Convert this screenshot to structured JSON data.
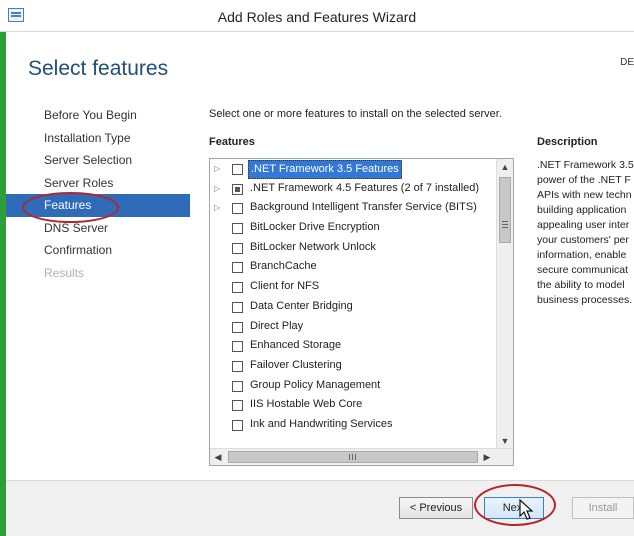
{
  "window": {
    "title": "Add Roles and Features Wizard",
    "icon": "server-manager-icon"
  },
  "header": {
    "page_title": "Select features",
    "destination_server": "DE"
  },
  "nav": {
    "items": [
      {
        "label": "Before You Begin",
        "state": "normal"
      },
      {
        "label": "Installation Type",
        "state": "normal"
      },
      {
        "label": "Server Selection",
        "state": "normal"
      },
      {
        "label": "Server Roles",
        "state": "normal"
      },
      {
        "label": "Features",
        "state": "active"
      },
      {
        "label": "DNS Server",
        "state": "normal"
      },
      {
        "label": "Confirmation",
        "state": "normal"
      },
      {
        "label": "Results",
        "state": "disabled"
      }
    ]
  },
  "main": {
    "instruction": "Select one or more features to install on the selected server.",
    "features_heading": "Features",
    "description_heading": "Description",
    "features": [
      {
        "label": ".NET Framework 3.5 Features",
        "expandable": true,
        "checked": "none",
        "selected": true
      },
      {
        "label": ".NET Framework 4.5 Features (2 of 7 installed)",
        "expandable": true,
        "checked": "partial",
        "selected": false
      },
      {
        "label": "Background Intelligent Transfer Service (BITS)",
        "expandable": true,
        "checked": "none",
        "selected": false
      },
      {
        "label": "BitLocker Drive Encryption",
        "expandable": false,
        "checked": "none",
        "selected": false
      },
      {
        "label": "BitLocker Network Unlock",
        "expandable": false,
        "checked": "none",
        "selected": false
      },
      {
        "label": "BranchCache",
        "expandable": false,
        "checked": "none",
        "selected": false
      },
      {
        "label": "Client for NFS",
        "expandable": false,
        "checked": "none",
        "selected": false
      },
      {
        "label": "Data Center Bridging",
        "expandable": false,
        "checked": "none",
        "selected": false
      },
      {
        "label": "Direct Play",
        "expandable": false,
        "checked": "none",
        "selected": false
      },
      {
        "label": "Enhanced Storage",
        "expandable": false,
        "checked": "none",
        "selected": false
      },
      {
        "label": "Failover Clustering",
        "expandable": false,
        "checked": "none",
        "selected": false
      },
      {
        "label": "Group Policy Management",
        "expandable": false,
        "checked": "none",
        "selected": false
      },
      {
        "label": "IIS Hostable Web Core",
        "expandable": false,
        "checked": "none",
        "selected": false
      },
      {
        "label": "Ink and Handwriting Services",
        "expandable": false,
        "checked": "none",
        "selected": false
      }
    ],
    "description_lines": [
      ".NET Framework 3.5",
      "power of the .NET F",
      "APIs with new techn",
      "building application",
      "appealing user inter",
      "your customers' per",
      "information, enable",
      "secure communicat",
      "the ability to model",
      "business processes."
    ]
  },
  "footer": {
    "previous_label": "< Previous",
    "next_label": "Next",
    "install_label": "Install"
  },
  "annotation_color": "#b3262a",
  "accent_color": "#2f6bb8"
}
